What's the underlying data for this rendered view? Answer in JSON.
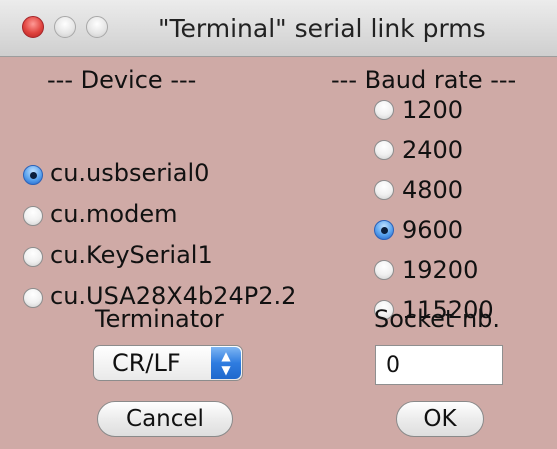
{
  "window": {
    "title": "\"Terminal\" serial link prms"
  },
  "device": {
    "header": "---  Device  ---",
    "options": [
      {
        "label": "cu.usbserial0",
        "selected": true
      },
      {
        "label": "cu.modem",
        "selected": false
      },
      {
        "label": "cu.KeySerial1",
        "selected": false
      },
      {
        "label": "cu.USA28X4b24P2.2",
        "selected": false
      }
    ]
  },
  "baud": {
    "header": "--- Baud rate ---",
    "options": [
      {
        "label": "1200",
        "selected": false
      },
      {
        "label": "2400",
        "selected": false
      },
      {
        "label": "4800",
        "selected": false
      },
      {
        "label": "9600",
        "selected": true
      },
      {
        "label": "19200",
        "selected": false
      },
      {
        "label": "115200",
        "selected": false
      }
    ]
  },
  "terminator": {
    "label": "Terminator",
    "value": "CR/LF"
  },
  "socket": {
    "label": "Socket nb.",
    "value": "0"
  },
  "buttons": {
    "cancel": "Cancel",
    "ok": "OK"
  },
  "colors": {
    "window_bg": "#cfaaa6",
    "radio_selected": "#2c62b8",
    "close_button": "#e0443f"
  }
}
